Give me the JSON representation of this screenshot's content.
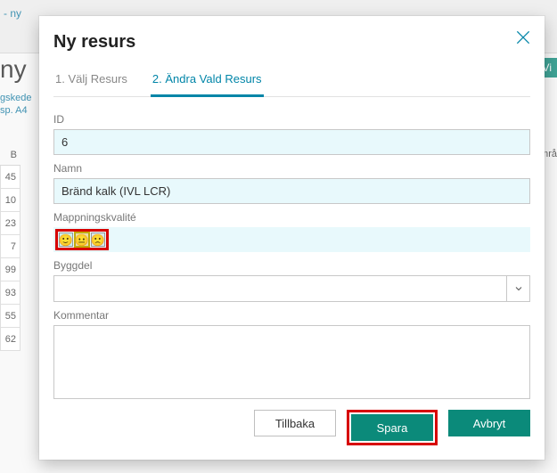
{
  "background": {
    "breadcrumb_tail": " - ny",
    "page_heading_fragment": "ny",
    "side_text1": "gskede",
    "side_text2": "sp. A4",
    "right_button_fragment": "Vi",
    "column_headers": {
      "first_partial": "B",
      "right_partial": "Områ"
    },
    "row_numbers": [
      "45",
      "10",
      "23",
      "7",
      "99",
      "93",
      "55",
      "62"
    ]
  },
  "modal": {
    "title": "Ny resurs",
    "tabs": {
      "t1": "1. Välj Resurs",
      "t2": "2. Ändra Vald Resurs"
    },
    "fields": {
      "id_label": "ID",
      "id_value": "6",
      "name_label": "Namn",
      "name_value": "Bränd kalk (IVL LCR)",
      "quality_label": "Mappningskvalité",
      "byggdel_label": "Byggdel",
      "byggdel_value": "",
      "comment_label": "Kommentar",
      "comment_value": ""
    },
    "faces": {
      "happy": "🙂",
      "neutral": "😐",
      "sad": "🙁"
    },
    "buttons": {
      "back": "Tillbaka",
      "save": "Spara",
      "cancel": "Avbryt"
    }
  }
}
